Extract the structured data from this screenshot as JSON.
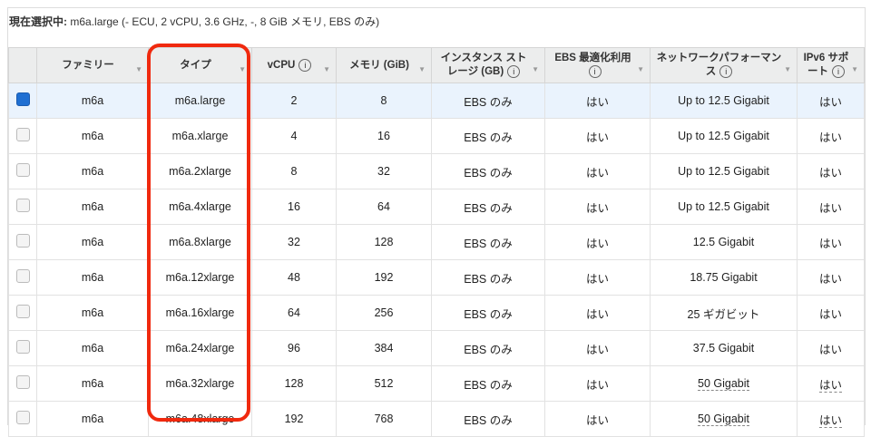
{
  "selection": {
    "label": "現在選択中:",
    "value": "m6a.large (- ECU, 2 vCPU, 3.6 GHz, -, 8 GiB メモリ, EBS のみ)"
  },
  "columns": [
    {
      "label": "ファミリー",
      "info": false
    },
    {
      "label": "タイプ",
      "info": false
    },
    {
      "label": "vCPU",
      "info": true
    },
    {
      "label": "メモリ (GiB)",
      "info": false
    },
    {
      "label": "インスタンス ストレージ (GB)",
      "info": true
    },
    {
      "label": "EBS 最適化利用",
      "info": true
    },
    {
      "label": "ネットワークパフォーマンス",
      "info": true
    },
    {
      "label": "IPv6 サポート",
      "info": true
    }
  ],
  "rows": [
    [
      "m6a",
      "m6a.large",
      "2",
      "8",
      "EBS のみ",
      "はい",
      "Up to 12.5 Gigabit",
      "はい"
    ],
    [
      "m6a",
      "m6a.xlarge",
      "4",
      "16",
      "EBS のみ",
      "はい",
      "Up to 12.5 Gigabit",
      "はい"
    ],
    [
      "m6a",
      "m6a.2xlarge",
      "8",
      "32",
      "EBS のみ",
      "はい",
      "Up to 12.5 Gigabit",
      "はい"
    ],
    [
      "m6a",
      "m6a.4xlarge",
      "16",
      "64",
      "EBS のみ",
      "はい",
      "Up to 12.5 Gigabit",
      "はい"
    ],
    [
      "m6a",
      "m6a.8xlarge",
      "32",
      "128",
      "EBS のみ",
      "はい",
      "12.5 Gigabit",
      "はい"
    ],
    [
      "m6a",
      "m6a.12xlarge",
      "48",
      "192",
      "EBS のみ",
      "はい",
      "18.75 Gigabit",
      "はい"
    ],
    [
      "m6a",
      "m6a.16xlarge",
      "64",
      "256",
      "EBS のみ",
      "はい",
      "25 ギガビット",
      "はい"
    ],
    [
      "m6a",
      "m6a.24xlarge",
      "96",
      "384",
      "EBS のみ",
      "はい",
      "37.5 Gigabit",
      "はい"
    ],
    [
      "m6a",
      "m6a.32xlarge",
      "128",
      "512",
      "EBS のみ",
      "はい",
      "50 Gigabit",
      "はい"
    ],
    [
      "m6a",
      "m6a.48xlarge",
      "192",
      "768",
      "EBS のみ",
      "はい",
      "50 Gigabit",
      "はい"
    ]
  ],
  "dashed_rows": [
    8,
    9
  ],
  "selected_row": 0,
  "highlight_color": "#f0290e"
}
